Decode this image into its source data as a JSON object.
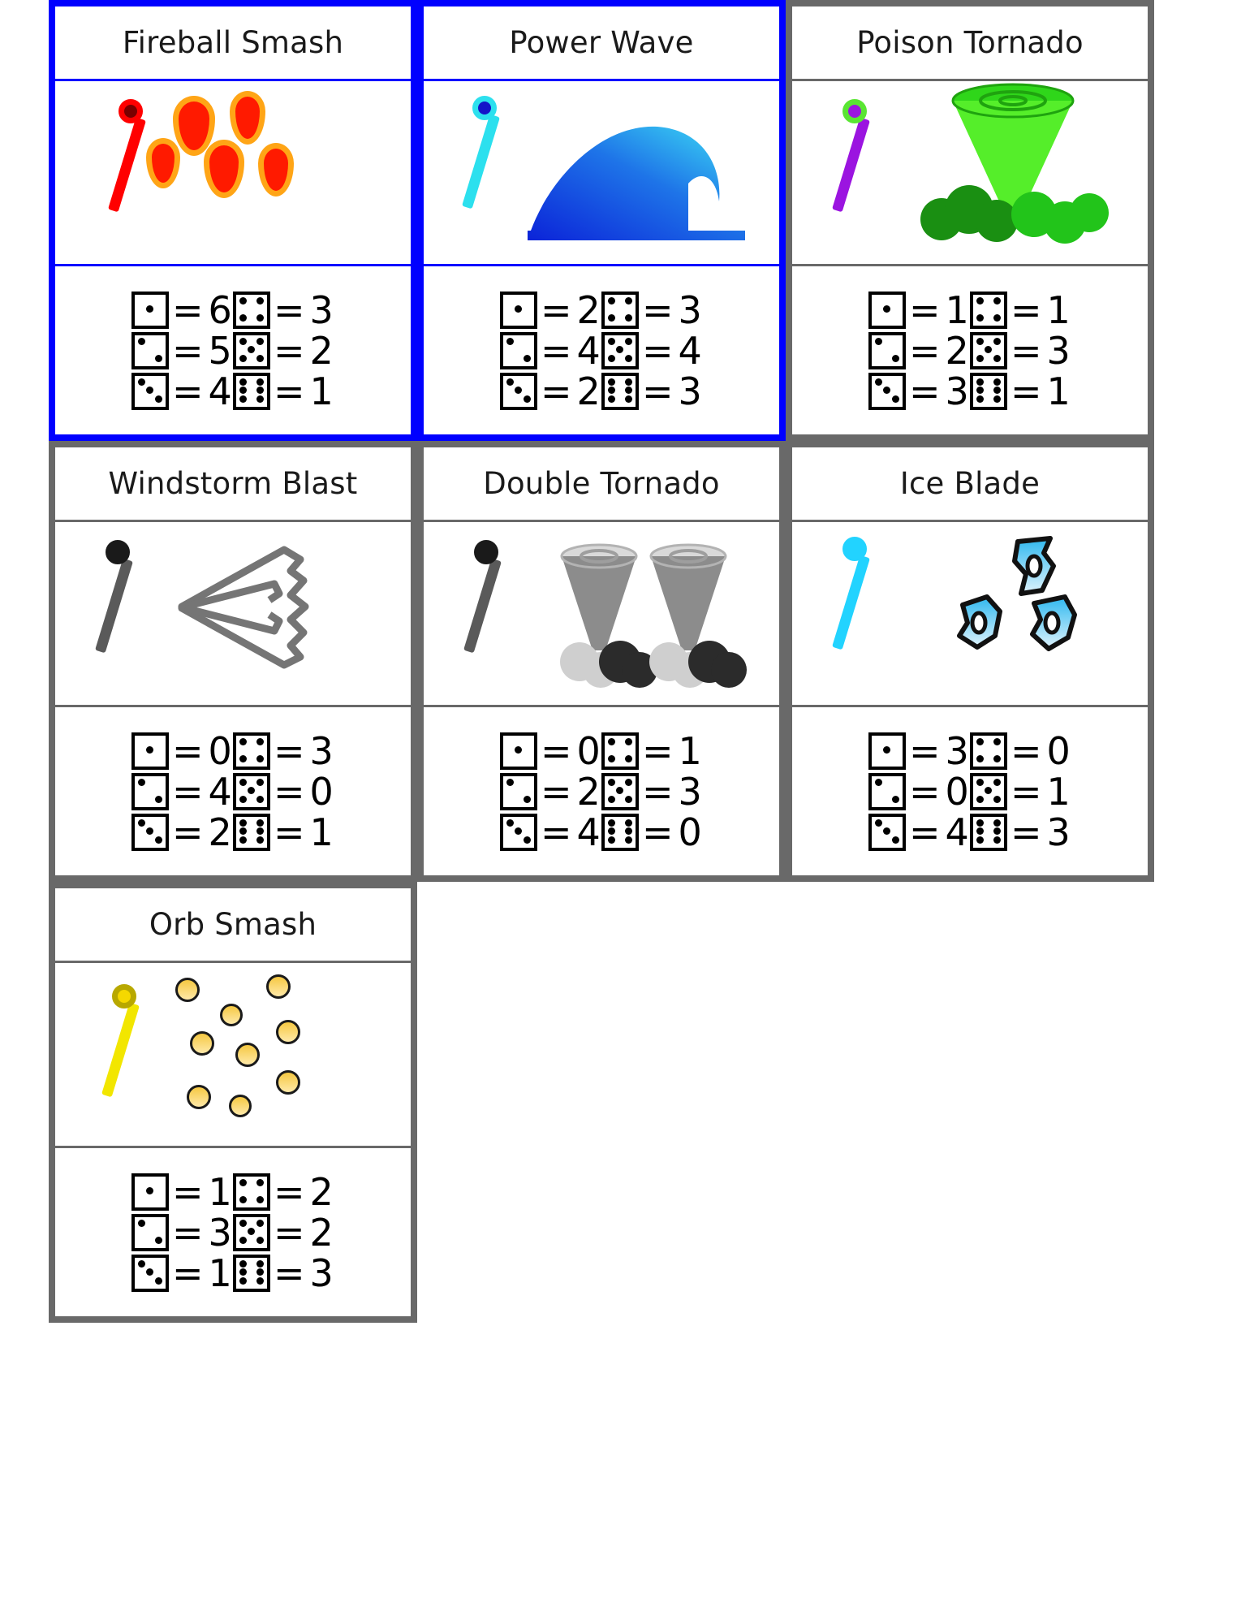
{
  "board": {
    "selected_border_color": "#0000ff",
    "normal_border_color": "#696969",
    "background": "#ffffff"
  },
  "dice_faces": {
    "one": "die-1",
    "two": "die-2",
    "three": "die-3",
    "four": "die-4",
    "five": "die-5",
    "six": "die-6"
  },
  "equals_symbol": "=",
  "cards": [
    {
      "id": "fireball-smash",
      "title": "Fireball Smash",
      "selected": true,
      "wand_color": "#ff0000",
      "orb_color": "#7a0000",
      "art": "fireball-art",
      "stats": [
        {
          "left_face": "one",
          "left_value": "6",
          "right_face": "four",
          "right_value": "3"
        },
        {
          "left_face": "two",
          "left_value": "5",
          "right_face": "five",
          "right_value": "2"
        },
        {
          "left_face": "three",
          "left_value": "4",
          "right_face": "six",
          "right_value": "1"
        }
      ]
    },
    {
      "id": "power-wave",
      "title": "Power Wave",
      "selected": true,
      "wand_color": "#2ce0ee",
      "orb_color": "#1414c8",
      "art": "wave-art",
      "stats": [
        {
          "left_face": "one",
          "left_value": "2",
          "right_face": "four",
          "right_value": "3"
        },
        {
          "left_face": "two",
          "left_value": "4",
          "right_face": "five",
          "right_value": "4"
        },
        {
          "left_face": "three",
          "left_value": "2",
          "right_face": "six",
          "right_value": "3"
        }
      ]
    },
    {
      "id": "poison-tornado",
      "title": "Poison Tornado",
      "selected": false,
      "wand_color": "#9b14e0",
      "orb_color": "#9b14e0",
      "art": "poison-tornado-art",
      "stats": [
        {
          "left_face": "one",
          "left_value": "1",
          "right_face": "four",
          "right_value": "1"
        },
        {
          "left_face": "two",
          "left_value": "2",
          "right_face": "five",
          "right_value": "3"
        },
        {
          "left_face": "three",
          "left_value": "3",
          "right_face": "six",
          "right_value": "1"
        }
      ]
    },
    {
      "id": "windstorm-blast",
      "title": "Windstorm Blast",
      "selected": false,
      "wand_color": "#5a5a5a",
      "orb_color": "#1a1a1a",
      "art": "windstorm-art",
      "stats": [
        {
          "left_face": "one",
          "left_value": "0",
          "right_face": "four",
          "right_value": "3"
        },
        {
          "left_face": "two",
          "left_value": "4",
          "right_face": "five",
          "right_value": "0"
        },
        {
          "left_face": "three",
          "left_value": "2",
          "right_face": "six",
          "right_value": "1"
        }
      ]
    },
    {
      "id": "double-tornado",
      "title": "Double Tornado",
      "selected": false,
      "wand_color": "#5a5a5a",
      "orb_color": "#1a1a1a",
      "art": "double-tornado-art",
      "stats": [
        {
          "left_face": "one",
          "left_value": "0",
          "right_face": "four",
          "right_value": "1"
        },
        {
          "left_face": "two",
          "left_value": "2",
          "right_face": "five",
          "right_value": "3"
        },
        {
          "left_face": "three",
          "left_value": "4",
          "right_face": "six",
          "right_value": "0"
        }
      ]
    },
    {
      "id": "ice-blade",
      "title": "Ice Blade",
      "selected": false,
      "wand_color": "#22d3ff",
      "orb_color": "#22d3ff",
      "art": "ice-blade-art",
      "stats": [
        {
          "left_face": "one",
          "left_value": "3",
          "right_face": "four",
          "right_value": "0"
        },
        {
          "left_face": "two",
          "left_value": "0",
          "right_face": "five",
          "right_value": "1"
        },
        {
          "left_face": "three",
          "left_value": "4",
          "right_face": "six",
          "right_value": "3"
        }
      ]
    },
    {
      "id": "orb-smash",
      "title": "Orb Smash",
      "selected": false,
      "wand_color": "#f2e600",
      "orb_color": "#f5d800",
      "art": "orb-smash-art",
      "stats": [
        {
          "left_face": "one",
          "left_value": "1",
          "right_face": "four",
          "right_value": "2"
        },
        {
          "left_face": "two",
          "left_value": "3",
          "right_face": "five",
          "right_value": "2"
        },
        {
          "left_face": "three",
          "left_value": "1",
          "right_face": "six",
          "right_value": "3"
        }
      ]
    }
  ]
}
